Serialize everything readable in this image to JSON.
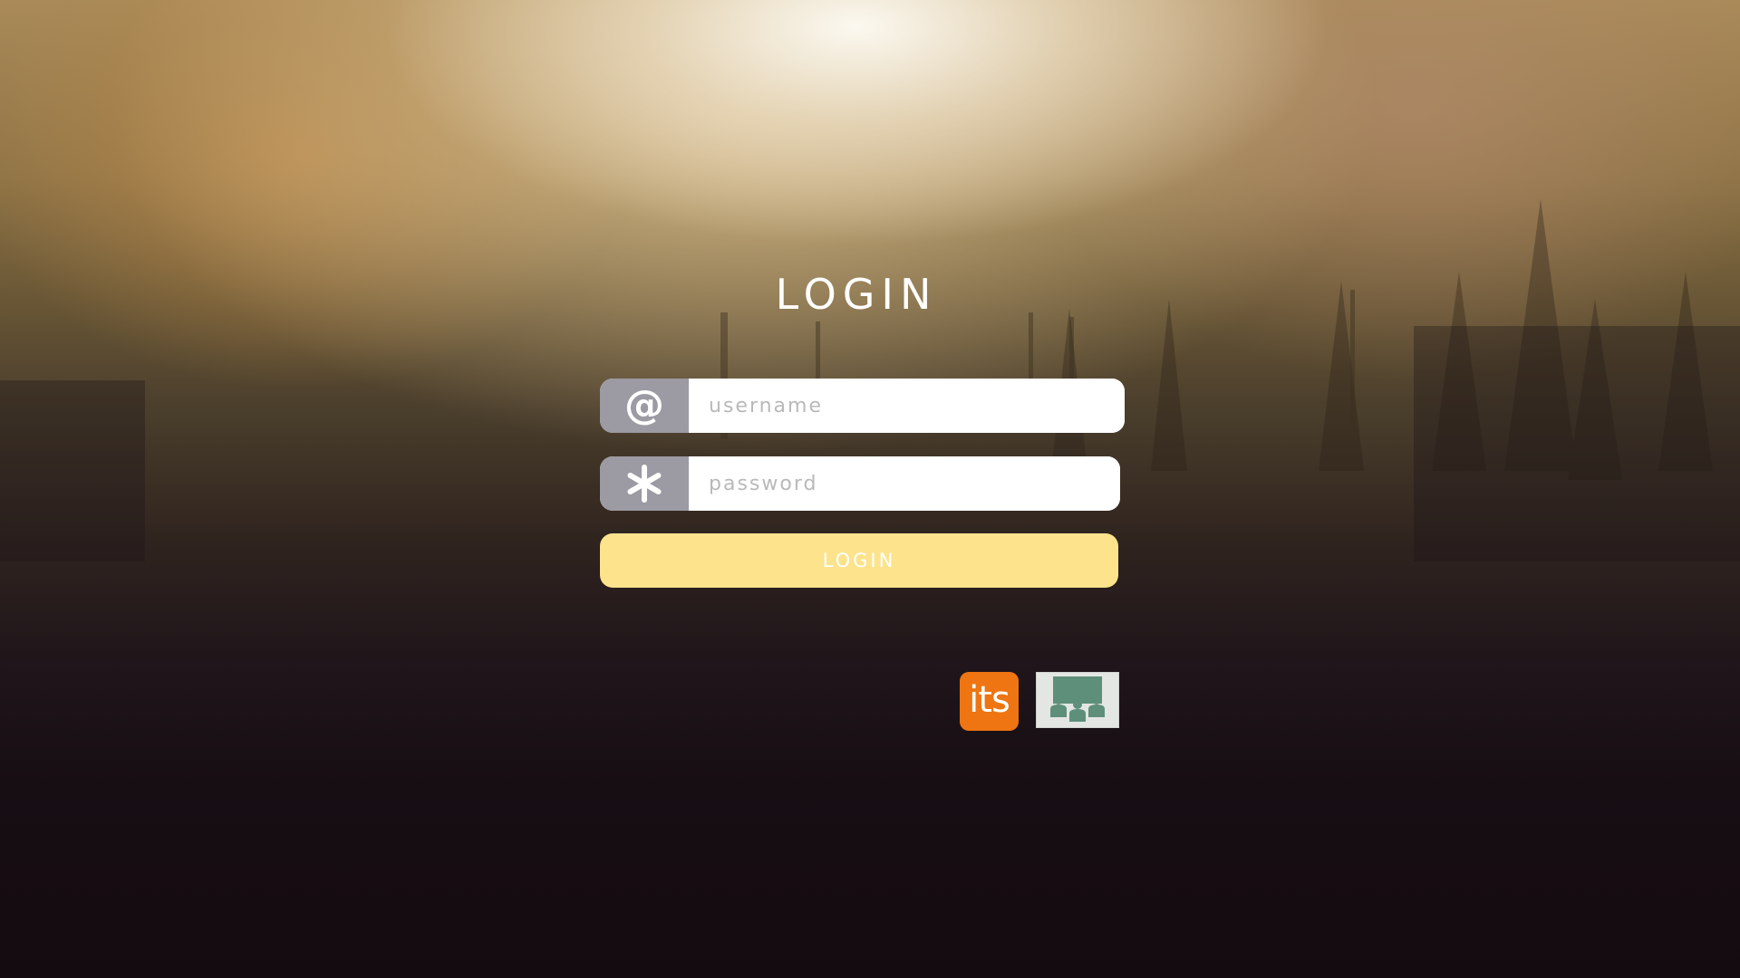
{
  "login": {
    "title": "LOGIN",
    "username": {
      "icon": "at-icon",
      "placeholder": "username",
      "value": ""
    },
    "password": {
      "icon": "asterisk-icon",
      "placeholder": "password",
      "value": ""
    },
    "submit_label": "LOGIN"
  },
  "logos": {
    "its_text": "its",
    "classroom_logo": "classroom-logo"
  },
  "colors": {
    "button": "#fde38c",
    "icon_addon": "#9c9aa2",
    "its_logo": "#ee7511",
    "classroom_logo": "#5e8f7a"
  }
}
